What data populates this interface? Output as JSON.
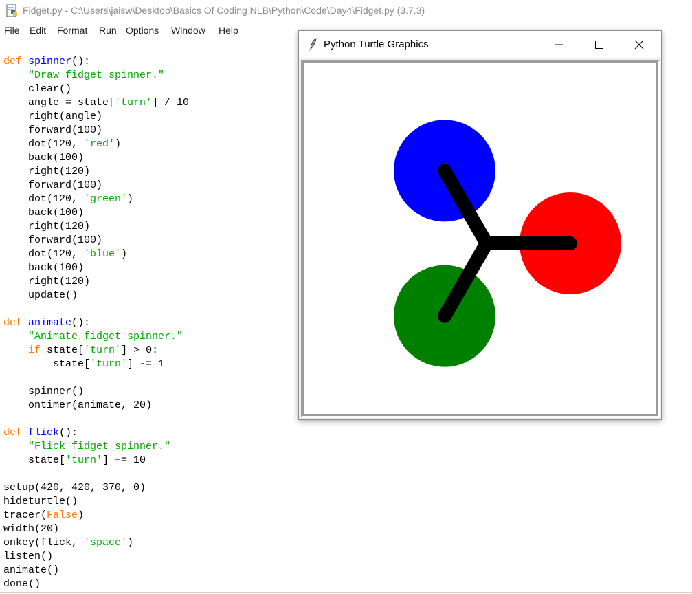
{
  "editor_window": {
    "title": "Fidget.py - C:\\Users\\jaisw\\Desktop\\Basics Of Coding NLB\\Python\\Code\\Day4\\Fidget.py (3.7.3)",
    "menu": [
      "File",
      "Edit",
      "Format",
      "Run",
      "Options",
      "Window",
      "Help"
    ]
  },
  "code_lines": [
    [
      [
        "kw",
        "def"
      ],
      [
        "t",
        " "
      ],
      [
        "fn",
        "spinner"
      ],
      [
        "t",
        "():"
      ]
    ],
    [
      [
        "t",
        "    "
      ],
      [
        "st",
        "\"Draw fidget spinner.\""
      ]
    ],
    [
      [
        "t",
        "    clear()"
      ]
    ],
    [
      [
        "t",
        "    angle = state["
      ],
      [
        "st",
        "'turn'"
      ],
      [
        "t",
        "] / 10"
      ]
    ],
    [
      [
        "t",
        "    right(angle)"
      ]
    ],
    [
      [
        "t",
        "    forward(100)"
      ]
    ],
    [
      [
        "t",
        "    dot(120, "
      ],
      [
        "st",
        "'red'"
      ],
      [
        "t",
        ")"
      ]
    ],
    [
      [
        "t",
        "    back(100)"
      ]
    ],
    [
      [
        "t",
        "    right(120)"
      ]
    ],
    [
      [
        "t",
        "    forward(100)"
      ]
    ],
    [
      [
        "t",
        "    dot(120, "
      ],
      [
        "st",
        "'green'"
      ],
      [
        "t",
        ")"
      ]
    ],
    [
      [
        "t",
        "    back(100)"
      ]
    ],
    [
      [
        "t",
        "    right(120)"
      ]
    ],
    [
      [
        "t",
        "    forward(100)"
      ]
    ],
    [
      [
        "t",
        "    dot(120, "
      ],
      [
        "st",
        "'blue'"
      ],
      [
        "t",
        ")"
      ]
    ],
    [
      [
        "t",
        "    back(100)"
      ]
    ],
    [
      [
        "t",
        "    right(120)"
      ]
    ],
    [
      [
        "t",
        "    update()"
      ]
    ],
    [],
    [
      [
        "kw",
        "def"
      ],
      [
        "t",
        " "
      ],
      [
        "fn",
        "animate"
      ],
      [
        "t",
        "():"
      ]
    ],
    [
      [
        "t",
        "    "
      ],
      [
        "st",
        "\"Animate fidget spinner.\""
      ]
    ],
    [
      [
        "t",
        "    "
      ],
      [
        "kw",
        "if"
      ],
      [
        "t",
        " state["
      ],
      [
        "st",
        "'turn'"
      ],
      [
        "t",
        "] > 0:"
      ]
    ],
    [
      [
        "t",
        "        state["
      ],
      [
        "st",
        "'turn'"
      ],
      [
        "t",
        "] -= 1"
      ]
    ],
    [],
    [
      [
        "t",
        "    spinner()"
      ]
    ],
    [
      [
        "t",
        "    ontimer(animate, 20)"
      ]
    ],
    [],
    [
      [
        "kw",
        "def"
      ],
      [
        "t",
        " "
      ],
      [
        "fn",
        "flick"
      ],
      [
        "t",
        "():"
      ]
    ],
    [
      [
        "t",
        "    "
      ],
      [
        "st",
        "\"Flick fidget spinner.\""
      ]
    ],
    [
      [
        "t",
        "    state["
      ],
      [
        "st",
        "'turn'"
      ],
      [
        "t",
        "] += 10"
      ]
    ],
    [],
    [
      [
        "t",
        "setup(420, 420, 370, 0)"
      ]
    ],
    [
      [
        "t",
        "hideturtle()"
      ]
    ],
    [
      [
        "t",
        "tracer("
      ],
      [
        "kw",
        "False"
      ],
      [
        "t",
        ")"
      ]
    ],
    [
      [
        "t",
        "width(20)"
      ]
    ],
    [
      [
        "t",
        "onkey(flick, "
      ],
      [
        "st",
        "'space'"
      ],
      [
        "t",
        ")"
      ]
    ],
    [
      [
        "t",
        "listen()"
      ]
    ],
    [
      [
        "t",
        "animate()"
      ]
    ],
    [
      [
        "t",
        "done()"
      ]
    ]
  ],
  "syntax_colors": {
    "kw": "#ff7700",
    "fn": "#0000ff",
    "st": "#00aa00",
    "t": "#000000"
  },
  "turtle_window": {
    "title": "Python Turtle Graphics",
    "controls": [
      "minimize-icon",
      "maximize-icon",
      "close-icon"
    ],
    "drawing": {
      "dots": [
        {
          "name": "red-dot",
          "color": "#ff0000"
        },
        {
          "name": "green-dot",
          "color": "#008000"
        },
        {
          "name": "blue-dot",
          "color": "#0000ff"
        }
      ],
      "line_color": "#000000"
    }
  }
}
